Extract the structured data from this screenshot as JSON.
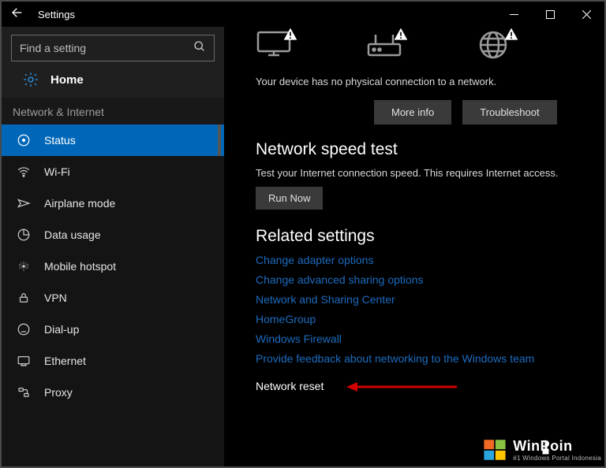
{
  "titlebar": {
    "title": "Settings"
  },
  "search": {
    "placeholder": "Find a setting"
  },
  "home": {
    "label": "Home"
  },
  "category": "Network & Internet",
  "nav": {
    "items": [
      {
        "label": "Status"
      },
      {
        "label": "Wi-Fi"
      },
      {
        "label": "Airplane mode"
      },
      {
        "label": "Data usage"
      },
      {
        "label": "Mobile hotspot"
      },
      {
        "label": "VPN"
      },
      {
        "label": "Dial-up"
      },
      {
        "label": "Ethernet"
      },
      {
        "label": "Proxy"
      }
    ]
  },
  "content": {
    "message": "Your device has no physical connection to a network.",
    "moreinfo": "More info",
    "troubleshoot": "Troubleshoot",
    "speed_heading": "Network speed test",
    "speed_desc": "Test your Internet connection speed. This requires Internet access.",
    "run_now": "Run Now",
    "related_heading": "Related settings",
    "links": [
      "Change adapter options",
      "Change advanced sharing options",
      "Network and Sharing Center",
      "HomeGroup",
      "Windows Firewall",
      "Provide feedback about networking to the Windows team"
    ],
    "network_reset": "Network reset"
  },
  "watermark": {
    "brand": "WinPoin",
    "tag": "#1 Windows Portal Indonesia"
  }
}
